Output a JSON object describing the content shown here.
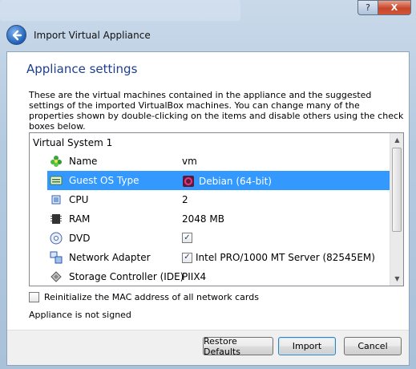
{
  "window": {
    "title": "Import Virtual Appliance",
    "help_label": "?",
    "close_label": "X"
  },
  "page": {
    "heading": "Appliance settings",
    "description": "These are the virtual machines contained in the appliance and the suggested settings of the imported VirtualBox machines. You can change many of the properties shown by double-clicking on the items and disable others using the check boxes below."
  },
  "tree": {
    "system_label": "Virtual System 1",
    "rows": [
      {
        "label": "Name",
        "value": "vm",
        "icon": "name-icon"
      },
      {
        "label": "Guest OS Type",
        "value": "Debian (64-bit)",
        "icon": "os-type-icon",
        "selected": true
      },
      {
        "label": "CPU",
        "value": "2",
        "icon": "cpu-icon"
      },
      {
        "label": "RAM",
        "value": "2048 MB",
        "icon": "ram-icon"
      },
      {
        "label": "DVD",
        "value": "",
        "icon": "dvd-icon",
        "checked": true
      },
      {
        "label": "Network Adapter",
        "value": "Intel PRO/1000 MT Server (82545EM)",
        "icon": "network-adapter-icon",
        "checked": true
      },
      {
        "label": "Storage Controller (IDE)",
        "value": "PIIX4",
        "icon": "storage-controller-icon"
      }
    ]
  },
  "options": {
    "reinit_mac_label": "Reinitialize the MAC address of all network cards",
    "reinit_mac_checked": false,
    "signed_status": "Appliance is not signed"
  },
  "buttons": {
    "restore_defaults": "Restore Defaults",
    "import": "Import",
    "cancel": "Cancel"
  },
  "colors": {
    "selection": "#3399ff",
    "heading": "#1e3f8f"
  }
}
